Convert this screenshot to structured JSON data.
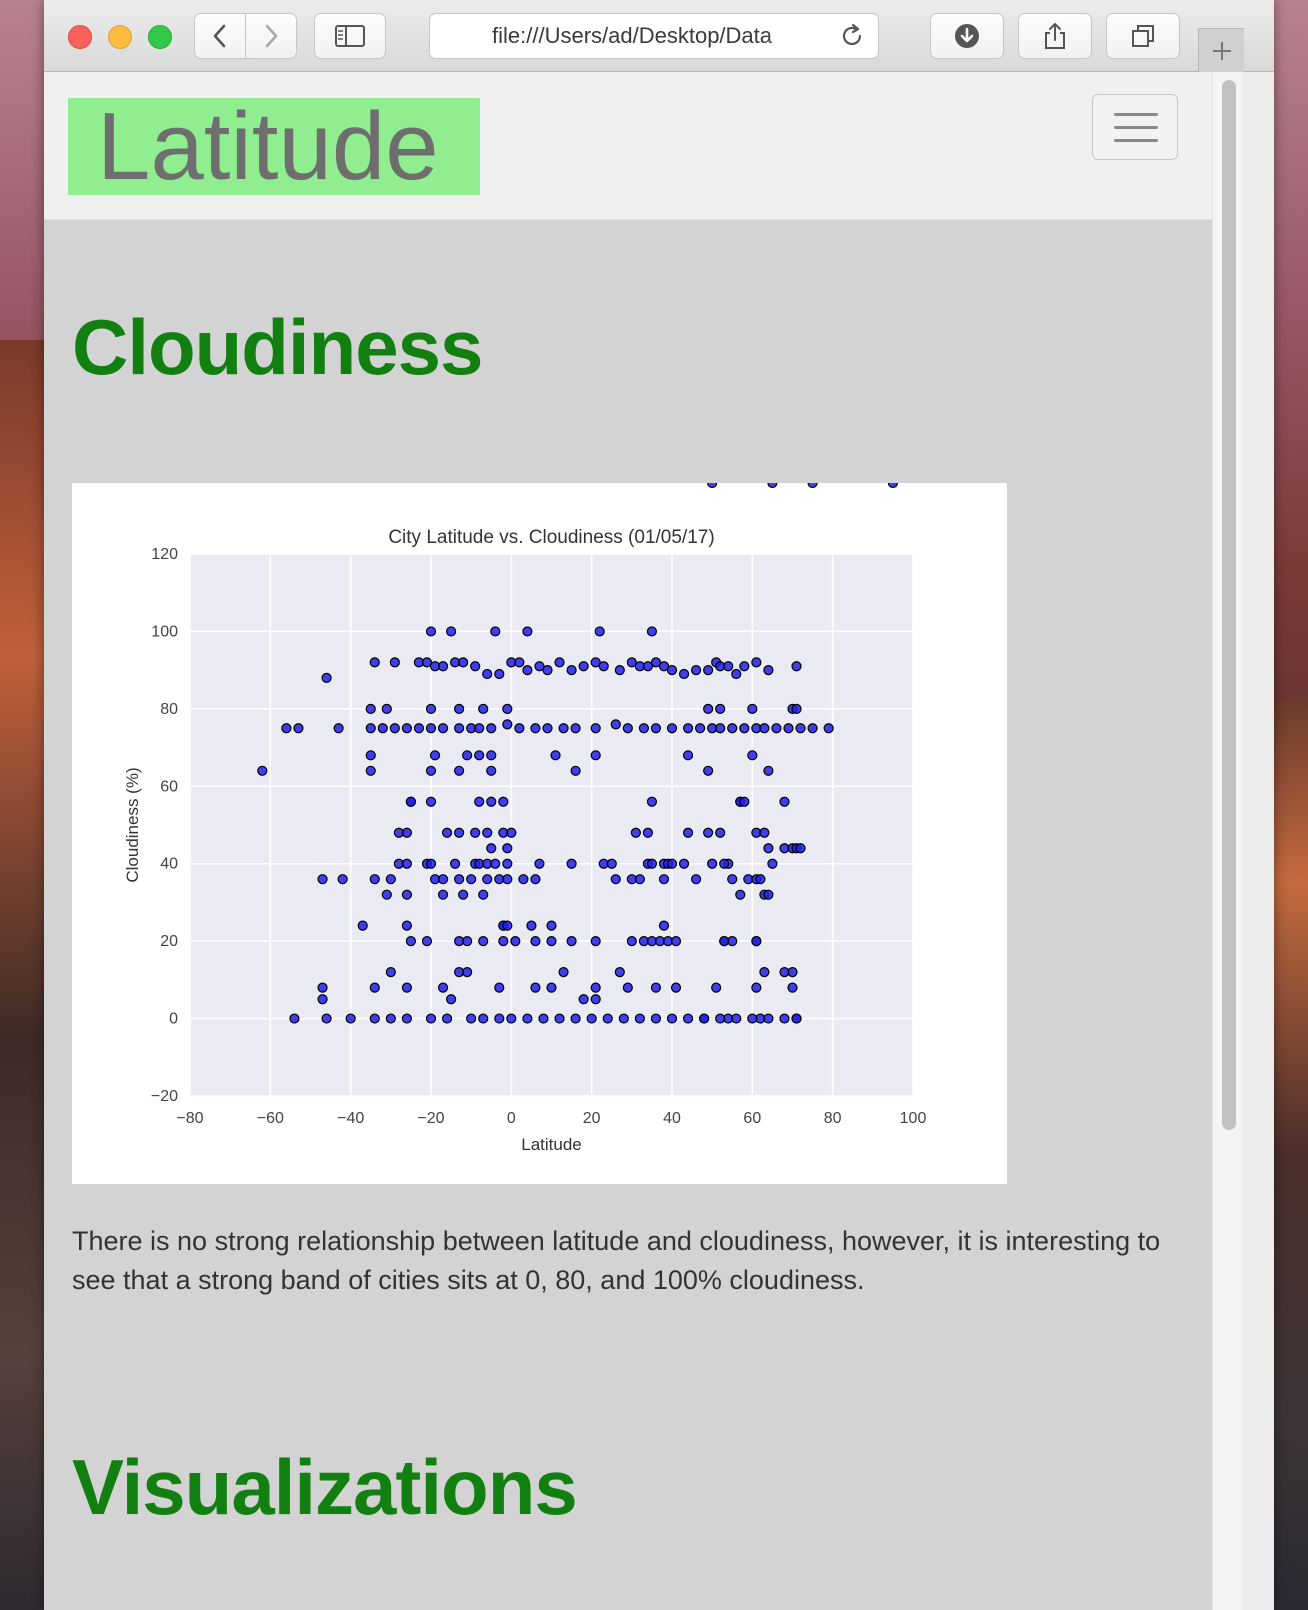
{
  "browser": {
    "url": "file:///Users/ad/Desktop/Data"
  },
  "navbar": {
    "brand": "Latitude"
  },
  "sections": {
    "cloudiness_heading": "Cloudiness",
    "description": "There is no strong relationship between latitude and cloudiness, however, it is interesting to see that a strong band of cities sits at 0, 80, and 100% cloudiness.",
    "visualizations_heading": "Visualizations"
  },
  "chart_data": {
    "type": "scatter",
    "title": "City Latitude vs. Cloudiness (01/05/17)",
    "xlabel": "Latitude",
    "ylabel": "Cloudiness (%)",
    "xlim": [
      -80,
      100
    ],
    "ylim": [
      -20,
      120
    ],
    "xticks": [
      -80,
      -60,
      -40,
      -20,
      0,
      20,
      40,
      60,
      80,
      100
    ],
    "yticks": [
      -20,
      0,
      20,
      40,
      60,
      80,
      100,
      120
    ],
    "grid": true,
    "marker_color": "#2020ee",
    "background": "#eaeaf2",
    "x": [
      -20,
      -15,
      -4,
      4,
      22,
      35,
      -34,
      -29,
      -23,
      -21,
      -19,
      -17,
      -14,
      -12,
      -9,
      -6,
      -3,
      0,
      2,
      4,
      7,
      9,
      12,
      15,
      18,
      21,
      23,
      27,
      30,
      32,
      34,
      36,
      38,
      40,
      43,
      46,
      49,
      51,
      52,
      54,
      56,
      58,
      61,
      64,
      71,
      -46,
      -56,
      -53,
      -43,
      -35,
      -32,
      -29,
      -26,
      -23,
      -20,
      -17,
      -13,
      -10,
      -8,
      -5,
      -1,
      2,
      6,
      9,
      13,
      16,
      21,
      26,
      29,
      33,
      36,
      40,
      44,
      47,
      50,
      52,
      55,
      58,
      61,
      63,
      66,
      69,
      72,
      75,
      79,
      -35,
      -31,
      -20,
      -13,
      -7,
      -1,
      49,
      52,
      60,
      70,
      71,
      -35,
      -19,
      -11,
      -8,
      -5,
      11,
      21,
      44,
      60,
      -35,
      -20,
      -13,
      -62,
      -5,
      16,
      49,
      64,
      -25,
      -25,
      -20,
      -8,
      -5,
      -2,
      35,
      57,
      57,
      58,
      68,
      -28,
      -26,
      -16,
      -13,
      -9,
      -6,
      -2,
      0,
      31,
      34,
      44,
      49,
      52,
      61,
      63,
      64,
      68,
      70,
      71,
      72,
      -5,
      -1,
      34,
      50,
      54,
      65,
      -28,
      -26,
      -21,
      -20,
      -14,
      -9,
      -8,
      -6,
      -4,
      -1,
      7,
      15,
      23,
      25,
      35,
      38,
      39,
      40,
      43,
      53,
      59,
      61,
      62,
      -47,
      -42,
      -34,
      -30,
      -19,
      -17,
      -13,
      -10,
      -6,
      -3,
      -1,
      3,
      6,
      26,
      30,
      32,
      38,
      46,
      55,
      57,
      63,
      64,
      -31,
      -26,
      -17,
      -12,
      -7,
      -2,
      5,
      10,
      -37,
      -26,
      -2,
      -1,
      38,
      53,
      55,
      61,
      -25,
      -21,
      -13,
      -11,
      -7,
      -2,
      1,
      6,
      10,
      15,
      21,
      30,
      33,
      35,
      37,
      39,
      41,
      53,
      61,
      63,
      68,
      70,
      -30,
      -13,
      -11,
      13,
      27,
      41,
      51,
      61,
      70,
      -47,
      -34,
      -26,
      -17,
      -3,
      6,
      10,
      21,
      29,
      36,
      48,
      54,
      62,
      71,
      -54,
      -46,
      -40,
      -34,
      -30,
      -26,
      -20,
      -16,
      -10,
      -7,
      -3,
      0,
      4,
      8,
      12,
      16,
      20,
      24,
      28,
      32,
      36,
      40,
      44,
      48,
      52,
      56,
      60,
      64,
      68,
      71,
      -47,
      -15,
      18,
      21,
      50,
      65,
      75,
      95
    ],
    "y": [
      100,
      100,
      100,
      100,
      100,
      100,
      92,
      92,
      92,
      92,
      91,
      91,
      92,
      92,
      91,
      89,
      89,
      92,
      92,
      90,
      91,
      90,
      92,
      90,
      91,
      92,
      91,
      90,
      92,
      91,
      91,
      92,
      91,
      90,
      89,
      90,
      90,
      92,
      91,
      91,
      89,
      91,
      92,
      90,
      91,
      88,
      75,
      75,
      75,
      75,
      75,
      75,
      75,
      75,
      75,
      75,
      75,
      75,
      75,
      75,
      76,
      75,
      75,
      75,
      75,
      75,
      75,
      76,
      75,
      75,
      75,
      75,
      75,
      75,
      75,
      75,
      75,
      75,
      75,
      75,
      75,
      75,
      75,
      75,
      75,
      80,
      80,
      80,
      80,
      80,
      80,
      80,
      80,
      80,
      80,
      80,
      68,
      68,
      68,
      68,
      68,
      68,
      68,
      68,
      68,
      64,
      64,
      64,
      64,
      64,
      64,
      64,
      64,
      56,
      56,
      56,
      56,
      56,
      56,
      56,
      56,
      56,
      56,
      56,
      48,
      48,
      48,
      48,
      48,
      48,
      48,
      48,
      48,
      48,
      48,
      48,
      48,
      48,
      48,
      44,
      44,
      44,
      44,
      44,
      44,
      44,
      40,
      40,
      40,
      40,
      40,
      40,
      40,
      40,
      40,
      40,
      40,
      40,
      40,
      40,
      40,
      40,
      40,
      40,
      40,
      40,
      40,
      40,
      40,
      40,
      36,
      36,
      36,
      36,
      36,
      36,
      36,
      36,
      36,
      36,
      36,
      36,
      36,
      36,
      36,
      36,
      36,
      36,
      36,
      36,
      36,
      36,
      32,
      32,
      32,
      32,
      32,
      32,
      32,
      32,
      24,
      24,
      24,
      24,
      24,
      24,
      24,
      24,
      20,
      20,
      20,
      20,
      20,
      20,
      20,
      20,
      20,
      20,
      20,
      20,
      20,
      20,
      20,
      20,
      20,
      20,
      20,
      20,
      20,
      20,
      12,
      12,
      12,
      12,
      12,
      12,
      12,
      12,
      8,
      8,
      8,
      8,
      8,
      8,
      8,
      8,
      8,
      8,
      8,
      8,
      8,
      8,
      0,
      0,
      0,
      0,
      0,
      0,
      0,
      0,
      0,
      0,
      0,
      0,
      0,
      0,
      0,
      0,
      0,
      0,
      0,
      0,
      0,
      0,
      0,
      0,
      0,
      0,
      0,
      0,
      0,
      0,
      0,
      0,
      0,
      0,
      5,
      5,
      5,
      5
    ]
  }
}
